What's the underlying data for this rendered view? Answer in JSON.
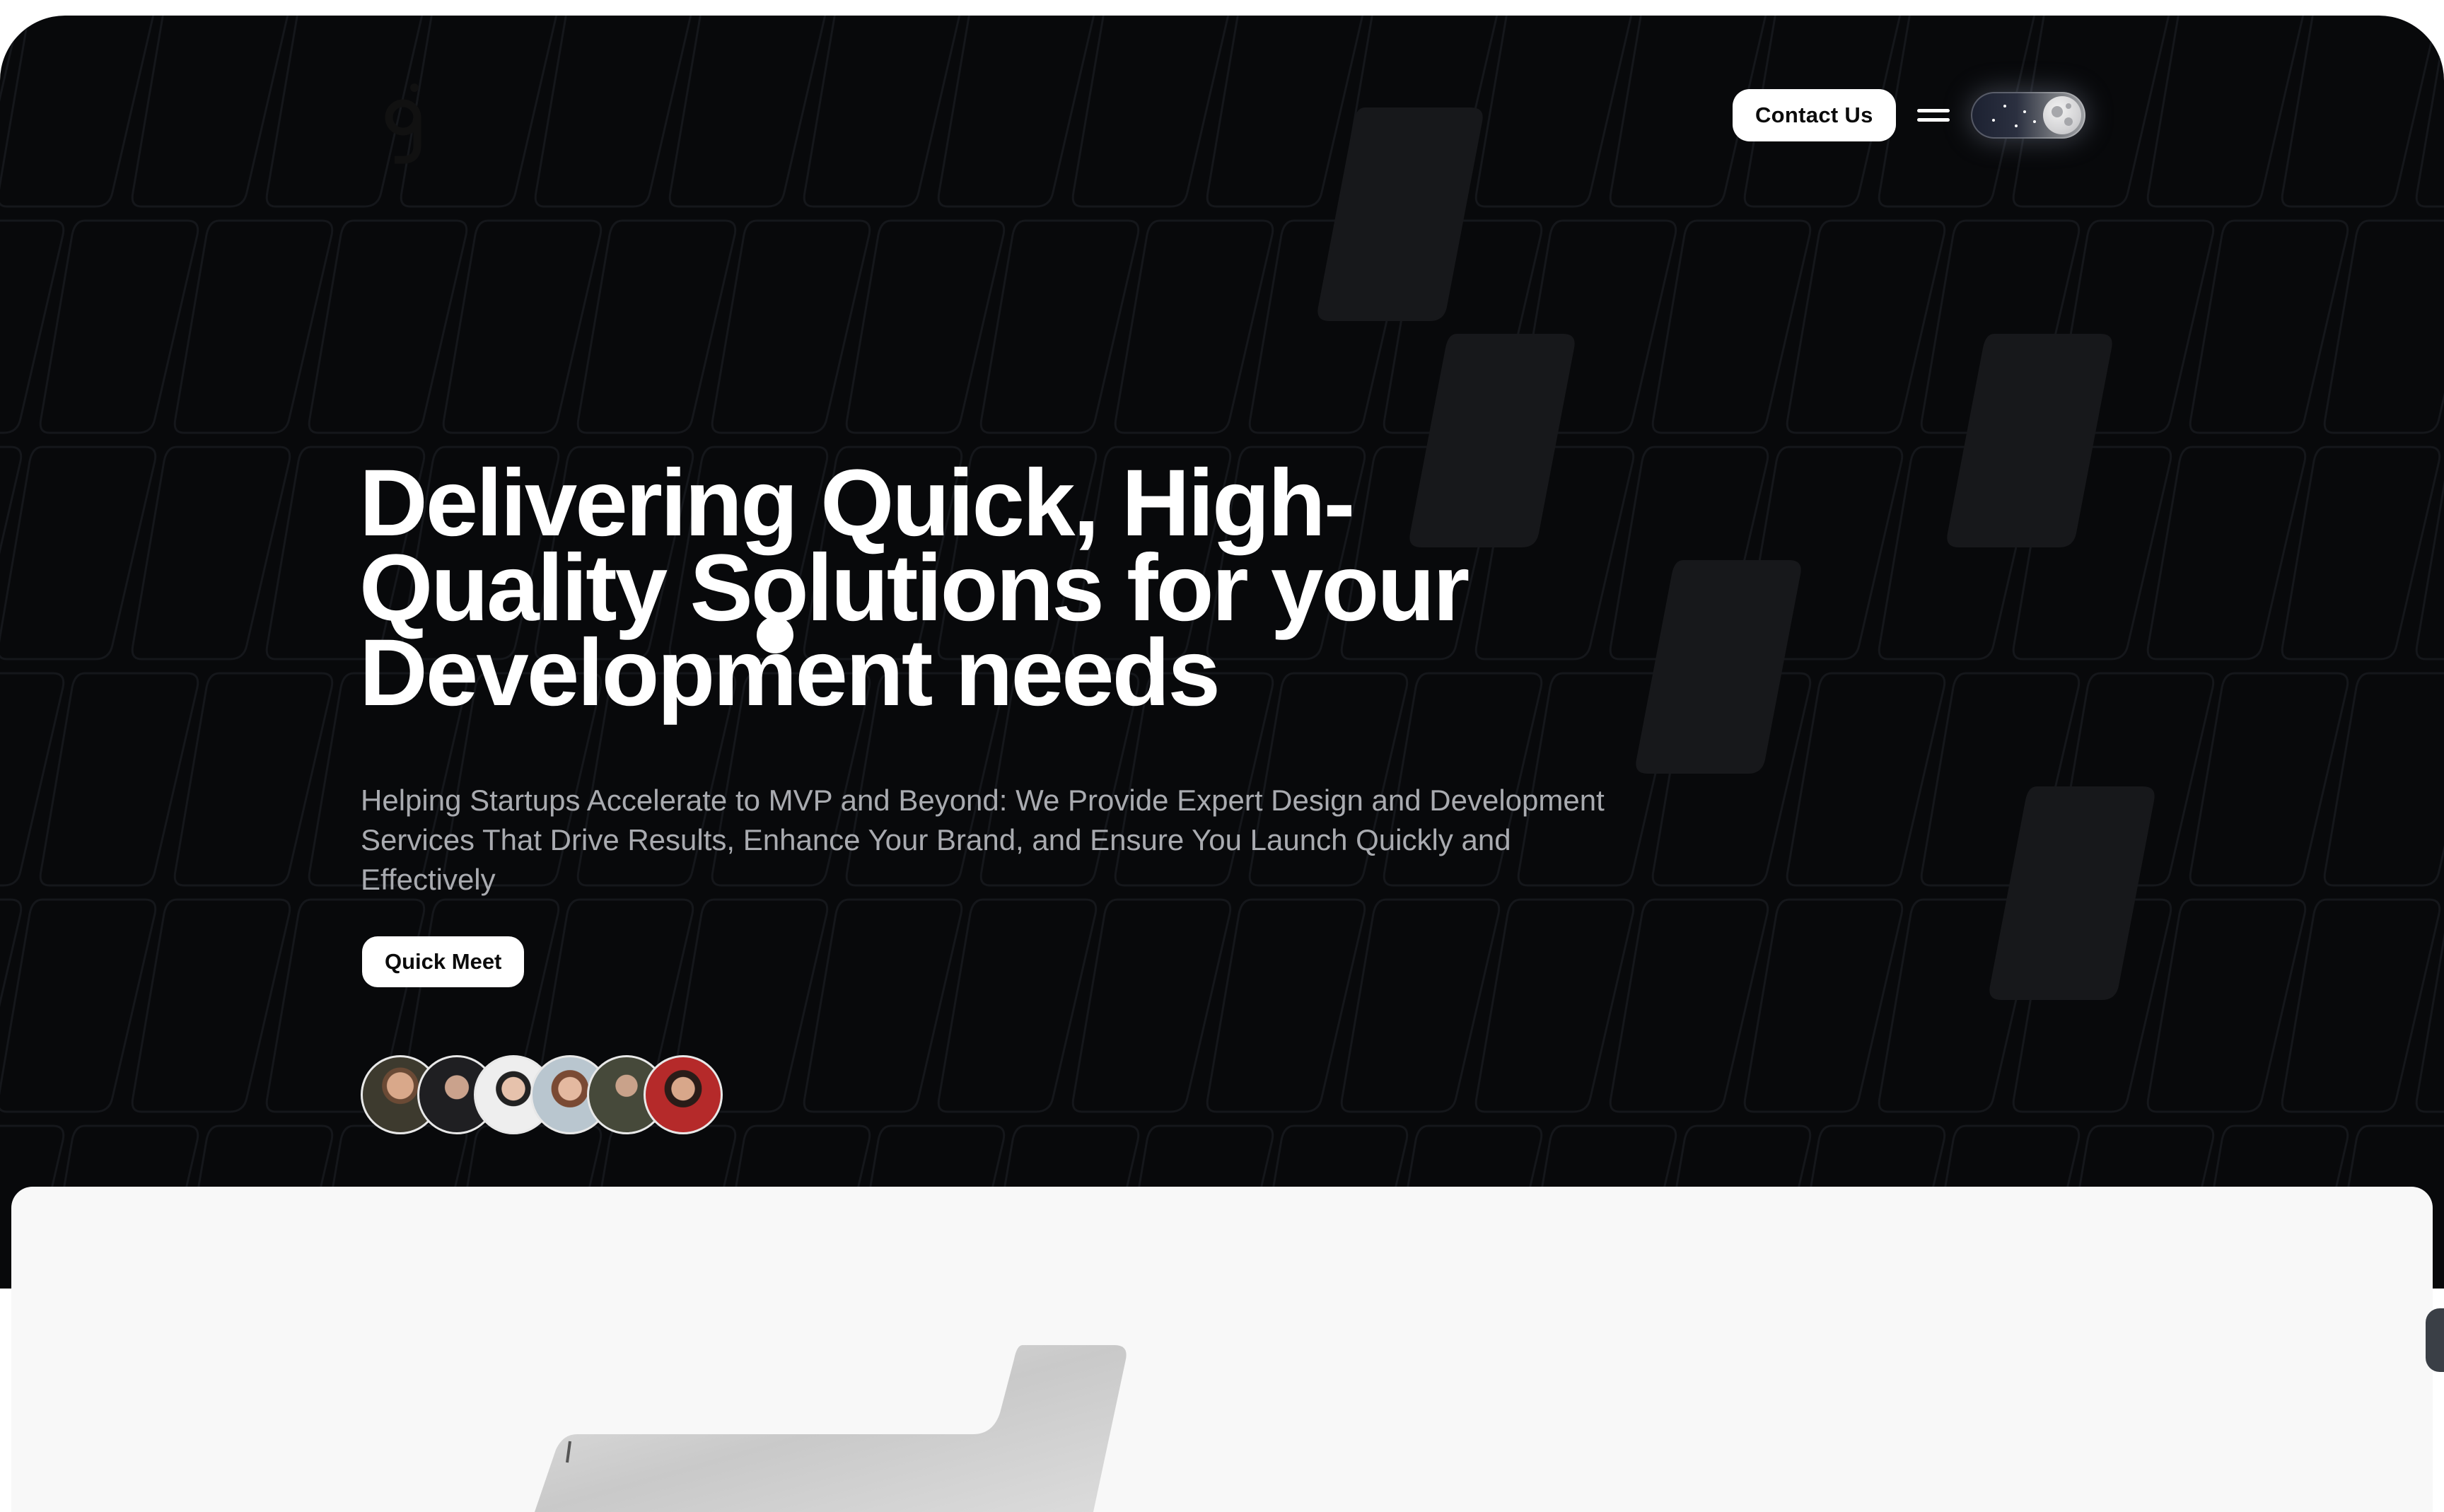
{
  "nav": {
    "contact_label": "Contact Us"
  },
  "hero": {
    "title_line_1": "Delivering Quick, High-",
    "title_line_2": "Quality Solutions for your",
    "title_line_3": "Development needs",
    "subtitle": "Helping Startups Accelerate to MVP and Beyond: We Provide Expert Design and Development Services That Drive Results, Enhance Your Brand, and Ensure You Launch Quickly and Effectively",
    "cta_label": "Quick Meet",
    "avatar_count": 6
  },
  "icons": {
    "logo": "brand-logo-icon",
    "menu": "hamburger-menu-icon",
    "theme": "dark-mode-toggle"
  },
  "colors": {
    "hero_background": "#08090b",
    "lower_background": "#f8f8f8",
    "button_background": "#ffffff",
    "subtitle_text": "#a9abb0"
  }
}
